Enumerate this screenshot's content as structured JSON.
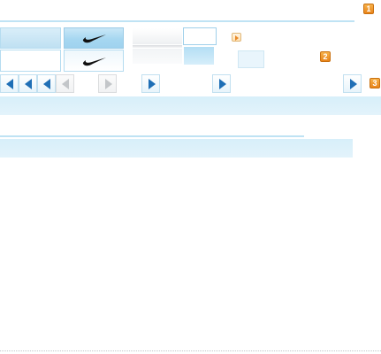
{
  "badges": {
    "badge_1": "1",
    "badge_2": "2",
    "badge_3": "3"
  },
  "icons": {
    "swoosh": "swoosh-logo-icon",
    "play": "play-icon",
    "arrow_left": "arrow-left-icon",
    "arrow_right": "arrow-right-icon"
  },
  "colors": {
    "accent_blue": "#1f6fb6",
    "tile_blue": "#bfe0f2",
    "band_blue": "#d7effa",
    "badge_orange": "#e9841a",
    "disabled_gray": "#c3c6c9"
  }
}
